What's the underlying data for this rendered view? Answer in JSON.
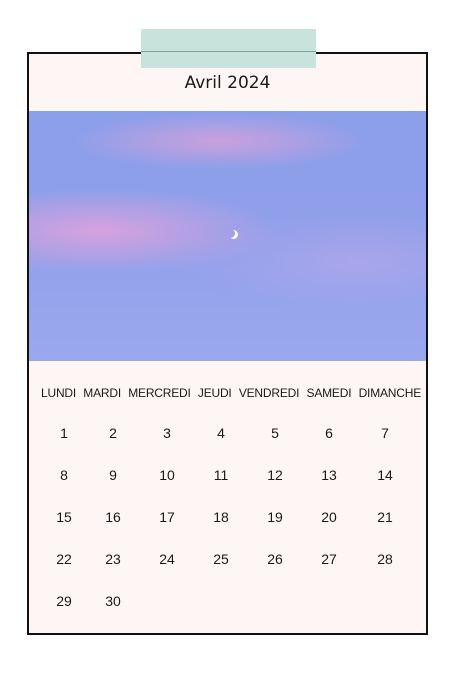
{
  "calendar": {
    "title": "Avril 2024",
    "weekdays": [
      "LUNDI",
      "MARDI",
      "MERCREDI",
      "JEUDI",
      "VENDREDI",
      "SAMEDI",
      "DIMANCHE"
    ],
    "days": [
      "1",
      "2",
      "3",
      "4",
      "5",
      "6",
      "7",
      "8",
      "9",
      "10",
      "11",
      "12",
      "13",
      "14",
      "15",
      "16",
      "17",
      "18",
      "19",
      "20",
      "21",
      "22",
      "23",
      "24",
      "25",
      "26",
      "27",
      "28",
      "29",
      "30"
    ]
  },
  "colors": {
    "tape": "#c8e3dc",
    "card_bg": "#fdf6f4",
    "border": "#111111",
    "sky": "#8c9fea",
    "cloud": "#e2a2dc"
  },
  "photo": {
    "subject": "crescent-moon"
  }
}
